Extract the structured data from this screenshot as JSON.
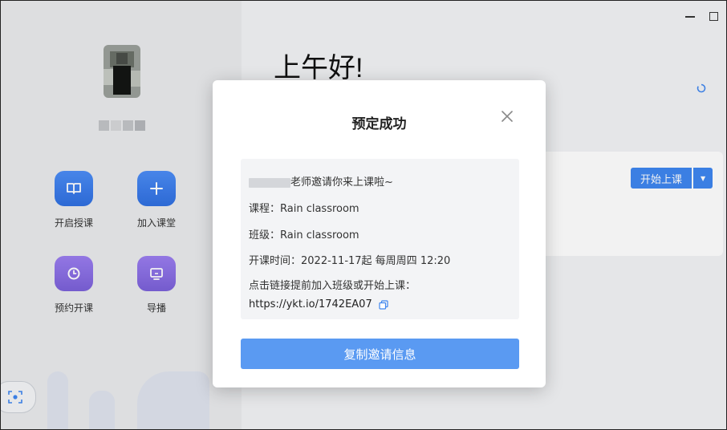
{
  "sidebar": {
    "tiles": [
      {
        "label": "开启授课",
        "icon": "book-icon"
      },
      {
        "label": "加入课堂",
        "icon": "plus-icon"
      },
      {
        "label": "预约开课",
        "icon": "clock-icon"
      },
      {
        "label": "导播",
        "icon": "monitor-icon"
      }
    ]
  },
  "main": {
    "greeting": "上午好!",
    "start_button": "开始上课"
  },
  "modal": {
    "title": "预定成功",
    "invite_suffix": "老师邀请你来上课啦~",
    "course": "课程：Rain classroom",
    "class": "班级：Rain classroom",
    "schedule": "开课时间：2022-11-17起 每周周四 12:20",
    "instruction": "点击链接提前加入班级或开始上课：",
    "link": "https://ykt.io/1742EA07",
    "copy_button": "复制邀请信息"
  },
  "colors": {
    "accent_blue": "#3f86f0",
    "tile_purple": "#8b70e6",
    "copy_button": "#5a9af2"
  }
}
